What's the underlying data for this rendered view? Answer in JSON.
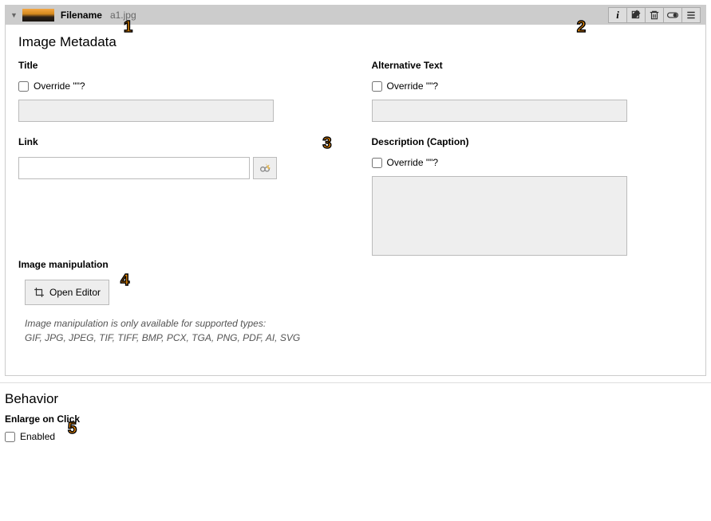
{
  "header": {
    "filename_label": "Filename",
    "filename_value": "a1.jpg"
  },
  "annotations": {
    "a1": "1",
    "a2": "2",
    "a3": "3",
    "a4": "4",
    "a5": "5"
  },
  "metadata": {
    "section_title": "Image Metadata",
    "title_label": "Title",
    "title_override": "Override \"\"?",
    "title_value": "",
    "alt_label": "Alternative Text",
    "alt_override": "Override \"\"?",
    "alt_value": "",
    "link_label": "Link",
    "link_value": "",
    "description_label": "Description (Caption)",
    "description_override": "Override \"\"?",
    "description_value": ""
  },
  "manipulation": {
    "label": "Image manipulation",
    "open_editor": "Open Editor",
    "help_line1": "Image manipulation is only available for supported types:",
    "help_line2": "GIF, JPG, JPEG, TIF, TIFF, BMP, PCX, TGA, PNG, PDF, AI, SVG"
  },
  "behavior": {
    "section_title": "Behavior",
    "enlarge_label": "Enlarge on Click",
    "enabled_label": "Enabled"
  }
}
